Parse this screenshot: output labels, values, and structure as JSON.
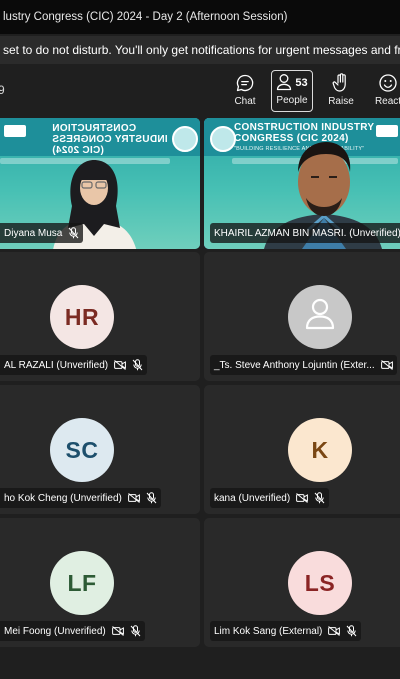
{
  "window": {
    "title": "lustry Congress (CIC) 2024 - Day 2 (Afternoon Session)"
  },
  "banner": {
    "text": "set to do not disturb. You'll only get notifications for urgent messages and fr"
  },
  "toolbar": {
    "timer": "9",
    "chat_label": "Chat",
    "people_label": "People",
    "people_count": "53",
    "raise_label": "Raise",
    "react_label": "React"
  },
  "slides": {
    "left_title": "CONSTRUCTION INDUSTRY CONGRESS (CIC 2024)",
    "right_title_line1": "CONSTRUCTION INDUSTRY",
    "right_title_line2": "CONGRESS (CIC 2024)",
    "right_subtitle": "\"BUILDING RESILIENCE AND SUSTAINABILITY\""
  },
  "participants": [
    {
      "name": "Diyana Musa",
      "type": "video",
      "muted": true
    },
    {
      "name": "KHAIRIL AZMAN BIN MASRI. (Unverified)",
      "type": "video",
      "muted": false
    },
    {
      "name": "AL RAZALI (Unverified)",
      "initials": "HR",
      "avatar_bg": "#f4e6e4",
      "avatar_fg": "#7b2b23"
    },
    {
      "name": "_Ts. Steve Anthony Lojuntin (Exter...",
      "initials": "",
      "avatar_bg": "#c8c8c8",
      "avatar_fg": "#ffffff"
    },
    {
      "name": "ho Kok Cheng (Unverified)",
      "initials": "SC",
      "avatar_bg": "#dde9f0",
      "avatar_fg": "#1d4f6c"
    },
    {
      "name": "kana (Unverified)",
      "initials": "K",
      "avatar_bg": "#fbe7cf",
      "avatar_fg": "#7a4713"
    },
    {
      "name": "Mei Foong (Unverified)",
      "initials": "LF",
      "avatar_bg": "#e0efe2",
      "avatar_fg": "#2d5b35"
    },
    {
      "name": "Lim Kok Sang (External)",
      "initials": "LS",
      "avatar_bg": "#f9dcdc",
      "avatar_fg": "#8a2424"
    }
  ],
  "colors": {
    "background": "#1f1f1f",
    "tile": "#292929",
    "active_outline": "#7f85f5",
    "slide_teal": "#3aa7a5"
  }
}
